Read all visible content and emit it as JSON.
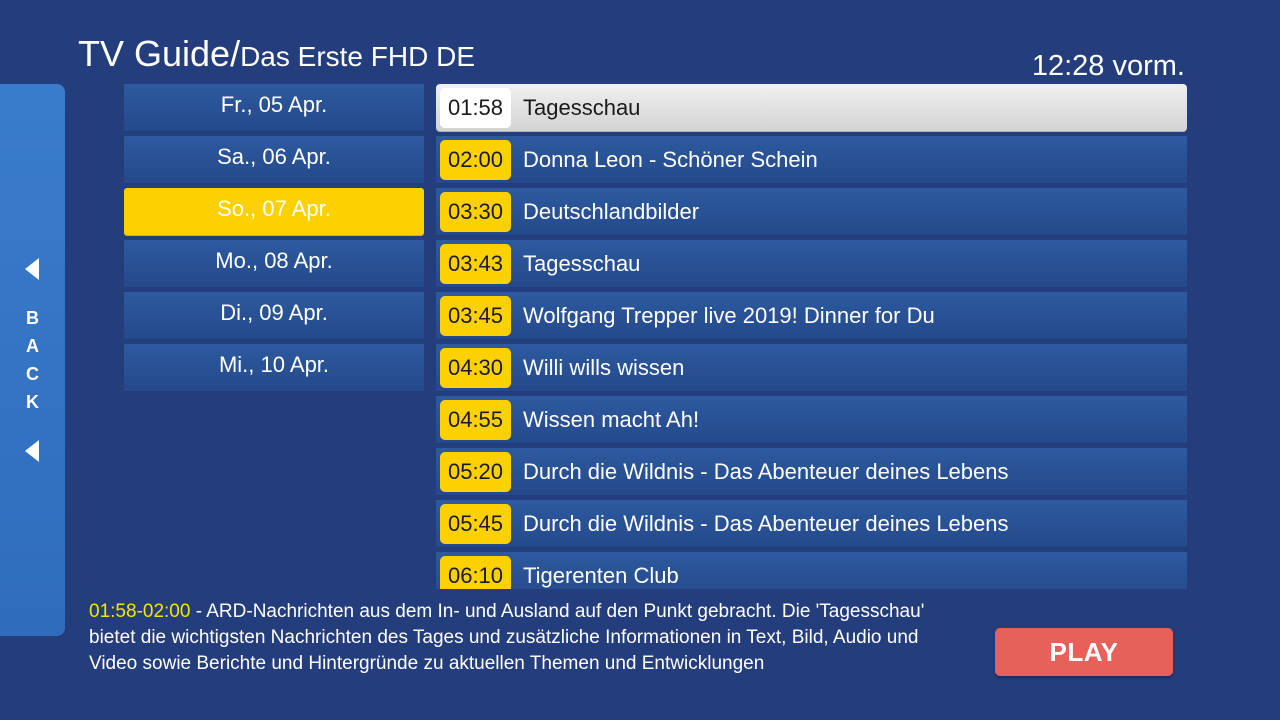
{
  "header": {
    "title": "TV Guide/",
    "channel": "Das Erste FHD DE",
    "clock": "12:28 vorm."
  },
  "back_panel": {
    "letters": [
      "B",
      "A",
      "C",
      "K"
    ],
    "icon": "chevron-left-icon"
  },
  "dates": [
    {
      "label": "Fr., 05  Apr.",
      "selected": false
    },
    {
      "label": "Sa., 06  Apr.",
      "selected": false
    },
    {
      "label": "So., 07  Apr.",
      "selected": true
    },
    {
      "label": "Mo., 08  Apr.",
      "selected": false
    },
    {
      "label": "Di., 09  Apr.",
      "selected": false
    },
    {
      "label": "Mi., 10  Apr.",
      "selected": false
    }
  ],
  "programs": [
    {
      "time": "01:58",
      "title": "Tagesschau",
      "selected": true
    },
    {
      "time": "02:00",
      "title": "Donna Leon - Schöner Schein",
      "selected": false
    },
    {
      "time": "03:30",
      "title": "Deutschlandbilder",
      "selected": false
    },
    {
      "time": "03:43",
      "title": "Tagesschau",
      "selected": false
    },
    {
      "time": "03:45",
      "title": "Wolfgang Trepper live 2019! Dinner for Du",
      "selected": false
    },
    {
      "time": "04:30",
      "title": "Willi wills wissen",
      "selected": false
    },
    {
      "time": "04:55",
      "title": "Wissen macht Ah!",
      "selected": false
    },
    {
      "time": "05:20",
      "title": "Durch die Wildnis - Das Abenteuer deines Lebens",
      "selected": false
    },
    {
      "time": "05:45",
      "title": "Durch die Wildnis - Das Abenteuer deines Lebens",
      "selected": false
    },
    {
      "time": "06:10",
      "title": "Tigerenten Club",
      "selected": false
    }
  ],
  "description": {
    "range": "01:58-02:00",
    "text": " - ARD-Nachrichten aus dem In- und Ausland auf den Punkt gebracht. Die 'Tagesschau' bietet die wichtigsten Nachrichten des Tages und zusätzliche Informationen in Text, Bild, Audio und Video sowie Berichte und Hintergründe zu aktuellen Themen und Entwicklungen"
  },
  "play_button": {
    "label": "PLAY"
  },
  "colors": {
    "background": "#243d7c",
    "accent_yellow": "#fdd000",
    "play_red": "#e8605a",
    "back_panel_blue": "#3a7ccc",
    "description_range": "#f3e600"
  }
}
